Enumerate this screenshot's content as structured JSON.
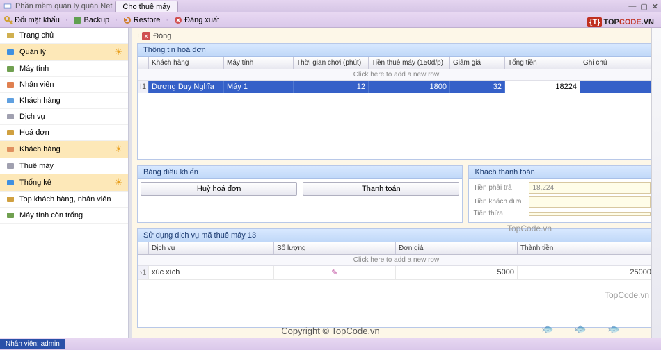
{
  "title": "Phần mềm quản lý quán Net",
  "active_tab": "Cho thuê máy",
  "toolbar": {
    "change_pw": "Đổi mật khẩu",
    "backup": "Backup",
    "restore": "Restore",
    "logout": "Đăng xuất"
  },
  "close_label": "Đóng",
  "sidebar": [
    {
      "label": "Trang chủ",
      "icon": "#d0b050",
      "hl": false,
      "arrow": false
    },
    {
      "label": "Quản lý",
      "icon": "#4090e0",
      "hl": true,
      "arrow": true
    },
    {
      "label": "Máy tính",
      "icon": "#70a050",
      "hl": false,
      "arrow": false
    },
    {
      "label": "Nhân viên",
      "icon": "#e08050",
      "hl": false,
      "arrow": false
    },
    {
      "label": "Khách hàng",
      "icon": "#60a0e0",
      "hl": false,
      "arrow": false
    },
    {
      "label": "Dịch vụ",
      "icon": "#a0a0b0",
      "hl": false,
      "arrow": false
    },
    {
      "label": "Hoá đơn",
      "icon": "#d0a040",
      "hl": false,
      "arrow": false
    },
    {
      "label": "Khách hàng",
      "icon": "#e09060",
      "hl": true,
      "arrow": true
    },
    {
      "label": "Thuê máy",
      "icon": "#a0a0b0",
      "hl": false,
      "arrow": false
    },
    {
      "label": "Thống kê",
      "icon": "#4090e0",
      "hl": true,
      "arrow": true
    },
    {
      "label": "Top khách hàng, nhân viên",
      "icon": "#d0a040",
      "hl": false,
      "arrow": false
    },
    {
      "label": "Máy tính còn trống",
      "icon": "#70a050",
      "hl": false,
      "arrow": false
    }
  ],
  "invoice_panel": {
    "title": "Thông tin hoá đơn",
    "headers": [
      "Khách hàng",
      "Máy tính",
      "Thời gian chơi (phút)",
      "Tiền thuê máy (150đ/p)",
      "Giảm giá",
      "Tổng tiền",
      "Ghi chú"
    ],
    "new_row_hint": "Click here to add a new row",
    "row": {
      "num": "1",
      "customer": "Dương Duy Nghĩa",
      "machine": "Máy 1",
      "play_time": "12",
      "rental": "1800",
      "discount": "32",
      "total": "18224",
      "note": ""
    }
  },
  "control_panel": {
    "title": "Bảng điều khiển",
    "cancel": "Huỷ hoá đơn",
    "pay": "Thanh toán"
  },
  "payment_panel": {
    "title": "Khách thanh toán",
    "must_pay_label": "Tiền phải trả",
    "must_pay_value": "18,224",
    "given_label": "Tiền khách đưa",
    "given_value": "",
    "change_label": "Tiền thừa",
    "change_value": ""
  },
  "service_panel": {
    "title": "Sử dụng dịch vụ mã thuê máy 13",
    "headers": [
      "Dịch vụ",
      "Số lượng",
      "Đơn giá",
      "Thành tiền"
    ],
    "new_row_hint": "Click here to add a new row",
    "row": {
      "num": "1",
      "service": "xúc xích",
      "qty": "",
      "price": "5000",
      "total": "25000"
    }
  },
  "watermark": "TopCode.vn",
  "logo": {
    "bracket": "{T}",
    "top": "TOP",
    "code": "CODE",
    "vn": ".VN"
  },
  "copyright": "Copyright © TopCode.vn",
  "status": "Nhân viên: admin"
}
